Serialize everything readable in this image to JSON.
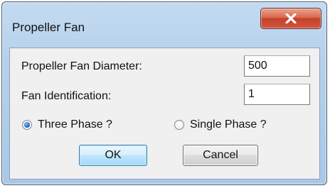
{
  "window": {
    "title": "Propeller Fan"
  },
  "fields": {
    "diameter_label": "Propeller Fan Diameter:",
    "diameter_value": "500",
    "identification_label": "Fan Identification:",
    "identification_value": "1"
  },
  "phase": {
    "three_phase_label": "Three Phase ?",
    "single_phase_label": "Single Phase ?",
    "selected": "three_phase"
  },
  "buttons": {
    "ok_label": "OK",
    "cancel_label": "Cancel"
  },
  "icons": {
    "close": "close-icon"
  },
  "colors": {
    "title_bar": "#b4d0ec",
    "close_button": "#c4412a",
    "client_area": "#f0f0f0",
    "ok_button_border": "#3c7fb1"
  }
}
